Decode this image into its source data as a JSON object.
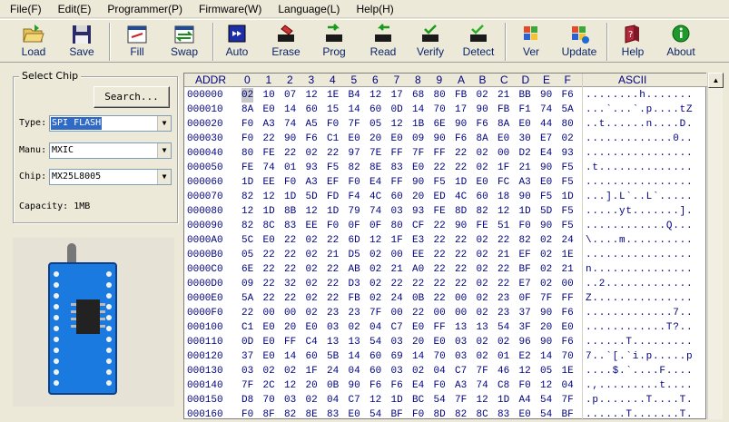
{
  "menu": [
    "File(F)",
    "Edit(E)",
    "Programmer(P)",
    "Firmware(W)",
    "Language(L)",
    "Help(H)"
  ],
  "toolbar": {
    "load": "Load",
    "save": "Save",
    "fill": "Fill",
    "swap": "Swap",
    "auto": "Auto",
    "erase": "Erase",
    "prog": "Prog",
    "read": "Read",
    "verify": "Verify",
    "detect": "Detect",
    "ver": "Ver",
    "update": "Update",
    "help": "Help",
    "about": "About"
  },
  "select_chip": {
    "title": "Select Chip",
    "search_label": "Search...",
    "type_label": "Type:",
    "type_value": "SPI FLASH",
    "manu_label": "Manu:",
    "manu_value": "MXIC",
    "chip_label": "Chip:",
    "chip_value": "MX25L8005",
    "capacity": "Capacity: 1MB"
  },
  "hex": {
    "addr_header": "ADDR",
    "columns": [
      "0",
      "1",
      "2",
      "3",
      "4",
      "5",
      "6",
      "7",
      "8",
      "9",
      "A",
      "B",
      "C",
      "D",
      "E",
      "F"
    ],
    "ascii_header": "ASCII",
    "rows": [
      {
        "addr": "000000",
        "bytes": [
          "02",
          "10",
          "07",
          "12",
          "1E",
          "B4",
          "12",
          "17",
          "68",
          "80",
          "FB",
          "02",
          "21",
          "BB",
          "90",
          "F6"
        ],
        "ascii": "........h......."
      },
      {
        "addr": "000010",
        "bytes": [
          "8A",
          "E0",
          "14",
          "60",
          "15",
          "14",
          "60",
          "0D",
          "14",
          "70",
          "17",
          "90",
          "FB",
          "F1",
          "74",
          "5A"
        ],
        "ascii": "...`...`.p....tZ"
      },
      {
        "addr": "000020",
        "bytes": [
          "F0",
          "A3",
          "74",
          "A5",
          "F0",
          "7F",
          "05",
          "12",
          "1B",
          "6E",
          "90",
          "F6",
          "8A",
          "E0",
          "44",
          "80"
        ],
        "ascii": "..t......n....D."
      },
      {
        "addr": "000030",
        "bytes": [
          "F0",
          "22",
          "90",
          "F6",
          "C1",
          "E0",
          "20",
          "E0",
          "09",
          "90",
          "F6",
          "8A",
          "E0",
          "30",
          "E7",
          "02"
        ],
        "ascii": ".............0.."
      },
      {
        "addr": "000040",
        "bytes": [
          "80",
          "FE",
          "22",
          "02",
          "22",
          "97",
          "7E",
          "FF",
          "7F",
          "FF",
          "22",
          "02",
          "00",
          "D2",
          "E4",
          "93"
        ],
        "ascii": "................"
      },
      {
        "addr": "000050",
        "bytes": [
          "FE",
          "74",
          "01",
          "93",
          "F5",
          "82",
          "8E",
          "83",
          "E0",
          "22",
          "22",
          "02",
          "1F",
          "21",
          "90",
          "F5"
        ],
        "ascii": ".t.............."
      },
      {
        "addr": "000060",
        "bytes": [
          "1D",
          "EE",
          "F0",
          "A3",
          "EF",
          "F0",
          "E4",
          "FF",
          "90",
          "F5",
          "1D",
          "E0",
          "FC",
          "A3",
          "E0",
          "F5"
        ],
        "ascii": "................"
      },
      {
        "addr": "000070",
        "bytes": [
          "82",
          "12",
          "1D",
          "5D",
          "FD",
          "F4",
          "4C",
          "60",
          "20",
          "ED",
          "4C",
          "60",
          "18",
          "90",
          "F5",
          "1D"
        ],
        "ascii": "...].L`..L`....."
      },
      {
        "addr": "000080",
        "bytes": [
          "12",
          "1D",
          "8B",
          "12",
          "1D",
          "79",
          "74",
          "03",
          "93",
          "FE",
          "8D",
          "82",
          "12",
          "1D",
          "5D",
          "F5"
        ],
        "ascii": ".....yt.......]."
      },
      {
        "addr": "000090",
        "bytes": [
          "82",
          "8C",
          "83",
          "EE",
          "F0",
          "0F",
          "0F",
          "80",
          "CF",
          "22",
          "90",
          "FE",
          "51",
          "F0",
          "90",
          "F5"
        ],
        "ascii": "............Q..."
      },
      {
        "addr": "0000A0",
        "bytes": [
          "5C",
          "E0",
          "22",
          "02",
          "22",
          "6D",
          "12",
          "1F",
          "E3",
          "22",
          "22",
          "02",
          "22",
          "82",
          "02",
          "24"
        ],
        "ascii": "\\....m.........."
      },
      {
        "addr": "0000B0",
        "bytes": [
          "05",
          "22",
          "22",
          "02",
          "21",
          "D5",
          "02",
          "00",
          "EE",
          "22",
          "22",
          "02",
          "21",
          "EF",
          "02",
          "1E"
        ],
        "ascii": "................"
      },
      {
        "addr": "0000C0",
        "bytes": [
          "6E",
          "22",
          "22",
          "02",
          "22",
          "AB",
          "02",
          "21",
          "A0",
          "22",
          "22",
          "02",
          "22",
          "BF",
          "02",
          "21"
        ],
        "ascii": "n..............."
      },
      {
        "addr": "0000D0",
        "bytes": [
          "09",
          "22",
          "32",
          "02",
          "22",
          "D3",
          "02",
          "22",
          "22",
          "22",
          "22",
          "02",
          "22",
          "E7",
          "02",
          "00"
        ],
        "ascii": "..2............."
      },
      {
        "addr": "0000E0",
        "bytes": [
          "5A",
          "22",
          "22",
          "02",
          "22",
          "FB",
          "02",
          "24",
          "0B",
          "22",
          "00",
          "02",
          "23",
          "0F",
          "7F",
          "FF"
        ],
        "ascii": "Z..............."
      },
      {
        "addr": "0000F0",
        "bytes": [
          "22",
          "00",
          "00",
          "02",
          "23",
          "23",
          "7F",
          "00",
          "22",
          "00",
          "00",
          "02",
          "23",
          "37",
          "90",
          "F6"
        ],
        "ascii": ".............7.."
      },
      {
        "addr": "000100",
        "bytes": [
          "C1",
          "E0",
          "20",
          "E0",
          "03",
          "02",
          "04",
          "C7",
          "E0",
          "FF",
          "13",
          "13",
          "54",
          "3F",
          "20",
          "E0"
        ],
        "ascii": "............T?.."
      },
      {
        "addr": "000110",
        "bytes": [
          "0D",
          "E0",
          "FF",
          "C4",
          "13",
          "13",
          "54",
          "03",
          "20",
          "E0",
          "03",
          "02",
          "02",
          "96",
          "90",
          "F6"
        ],
        "ascii": "......T........."
      },
      {
        "addr": "000120",
        "bytes": [
          "37",
          "E0",
          "14",
          "60",
          "5B",
          "14",
          "60",
          "69",
          "14",
          "70",
          "03",
          "02",
          "01",
          "E2",
          "14",
          "70"
        ],
        "ascii": "7..`[.`i.p.....p"
      },
      {
        "addr": "000130",
        "bytes": [
          "03",
          "02",
          "02",
          "1F",
          "24",
          "04",
          "60",
          "03",
          "02",
          "04",
          "C7",
          "7F",
          "46",
          "12",
          "05",
          "1E"
        ],
        "ascii": "....$.`....F...."
      },
      {
        "addr": "000140",
        "bytes": [
          "7F",
          "2C",
          "12",
          "20",
          "0B",
          "90",
          "F6",
          "F6",
          "E4",
          "F0",
          "A3",
          "74",
          "C8",
          "F0",
          "12",
          "04"
        ],
        "ascii": ".,.........t...."
      },
      {
        "addr": "000150",
        "bytes": [
          "D8",
          "70",
          "03",
          "02",
          "04",
          "C7",
          "12",
          "1D",
          "BC",
          "54",
          "7F",
          "12",
          "1D",
          "A4",
          "54",
          "7F"
        ],
        "ascii": ".p.......T....T."
      },
      {
        "addr": "000160",
        "bytes": [
          "F0",
          "8F",
          "82",
          "8E",
          "83",
          "E0",
          "54",
          "BF",
          "F0",
          "8D",
          "82",
          "8C",
          "83",
          "E0",
          "54",
          "BF"
        ],
        "ascii": "......T.......T."
      }
    ]
  },
  "colors": {
    "background": "#ece9d8",
    "hex_text": "#000080",
    "selection": "#316ac5",
    "toolbar_label": "#0a246a"
  }
}
